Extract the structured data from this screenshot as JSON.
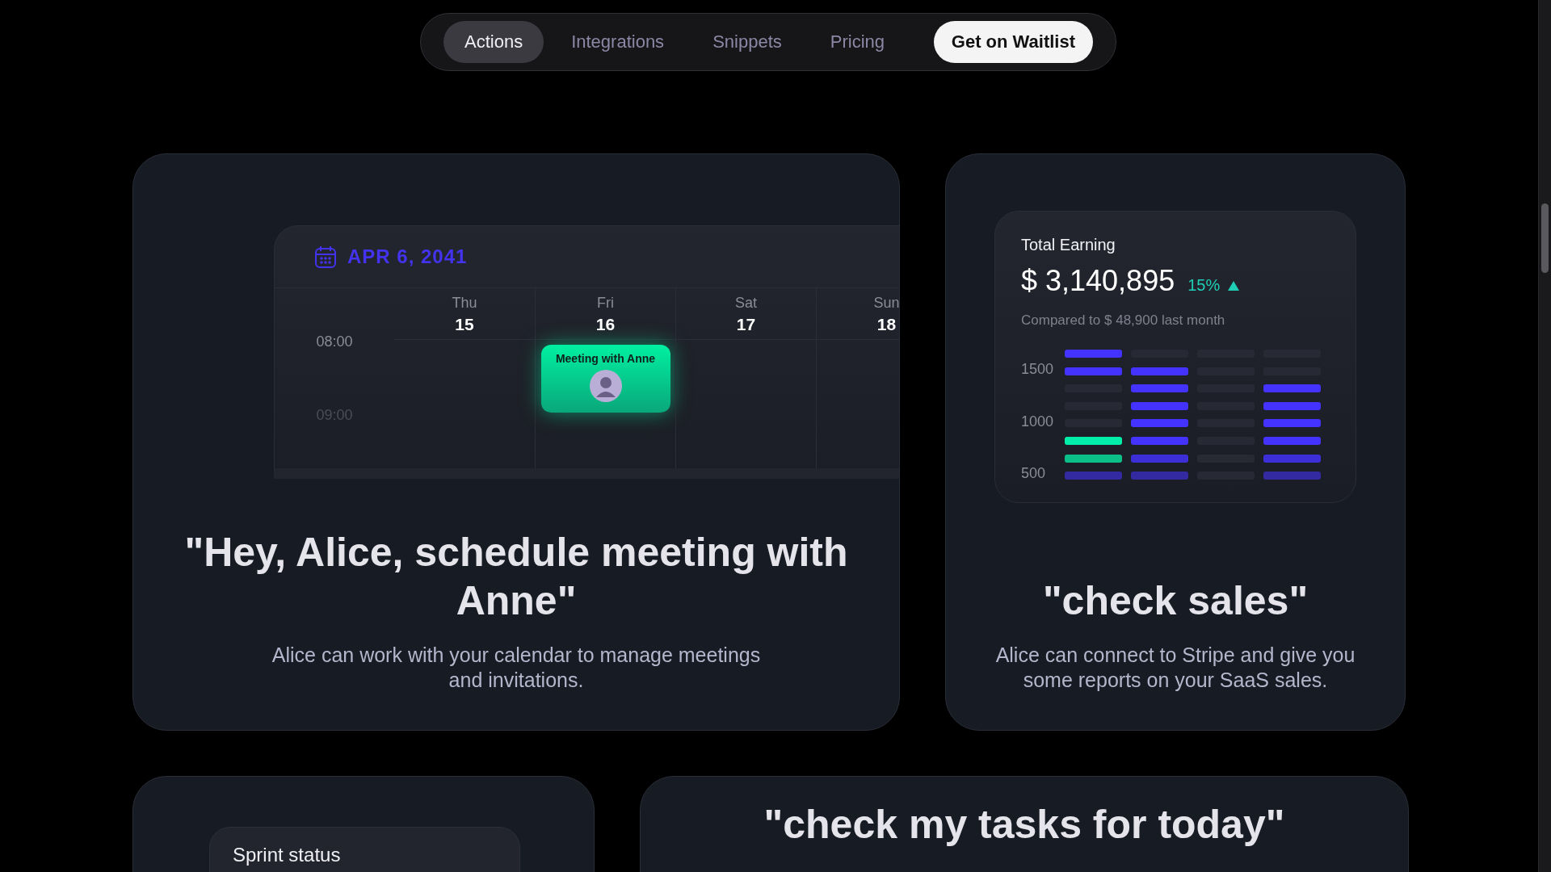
{
  "nav": {
    "items": [
      {
        "label": "Actions",
        "selected": true
      },
      {
        "label": "Integrations",
        "selected": false
      },
      {
        "label": "Snippets",
        "selected": false
      },
      {
        "label": "Pricing",
        "selected": false
      }
    ],
    "cta": "Get on Waitlist"
  },
  "calendar_card": {
    "date": "APR 6, 2041",
    "times": [
      "08:00",
      "09:00"
    ],
    "days": [
      {
        "name": "Thu",
        "number": "15"
      },
      {
        "name": "Fri",
        "number": "16",
        "events": [
          {
            "title": "Meeting with Anne"
          }
        ]
      },
      {
        "name": "Sat",
        "number": "17"
      },
      {
        "name": "Sun",
        "number": "18"
      }
    ],
    "quote": "\"Hey, Alice, schedule meeting with Anne\"",
    "description": "Alice can work with your calendar to manage meetings and invitations."
  },
  "sales_card": {
    "title": "Total Earning",
    "amount": "$ 3,140,895",
    "change": "15%",
    "rising": true,
    "comparison": "Compared to $ 48,900 last month",
    "y_labels": [
      "1500",
      "1000",
      "500"
    ],
    "bar_columns": [
      {
        "cells": [
          {
            "color": "#4433ff"
          },
          {
            "color": "#4433ff"
          },
          {
            "color": "#272a35"
          },
          {
            "color": "#272a35"
          },
          {
            "color": "#272a35"
          },
          {
            "color": "#00eeaa"
          },
          {
            "color": "#0bbf88"
          },
          {
            "color": "#3329a0"
          }
        ]
      },
      {
        "cells": [
          {
            "color": "#272a35"
          },
          {
            "color": "#4433ff"
          },
          {
            "color": "#4433ff"
          },
          {
            "color": "#4433ff"
          },
          {
            "color": "#4433ff"
          },
          {
            "color": "#4433ff"
          },
          {
            "color": "#3d2fd8"
          },
          {
            "color": "#3329a0"
          }
        ]
      },
      {
        "cells": [
          {
            "color": "#272a35"
          },
          {
            "color": "#272a35"
          },
          {
            "color": "#272a35"
          },
          {
            "color": "#272a35"
          },
          {
            "color": "#272a35"
          },
          {
            "color": "#272a35"
          },
          {
            "color": "#272a35"
          },
          {
            "color": "#272a35"
          }
        ]
      },
      {
        "cells": [
          {
            "color": "#272a35"
          },
          {
            "color": "#272a35"
          },
          {
            "color": "#4433ff"
          },
          {
            "color": "#4433ff"
          },
          {
            "color": "#4433ff"
          },
          {
            "color": "#4433ff"
          },
          {
            "color": "#3d2fd8"
          },
          {
            "color": "#3329a0"
          }
        ]
      }
    ],
    "quote": "\"check sales\"",
    "description": "Alice can connect to Stripe and give you some reports on your SaaS sales."
  },
  "sprint_card": {
    "title": "Sprint status"
  },
  "tasks_card": {
    "quote": "\"check my tasks for today\""
  }
}
